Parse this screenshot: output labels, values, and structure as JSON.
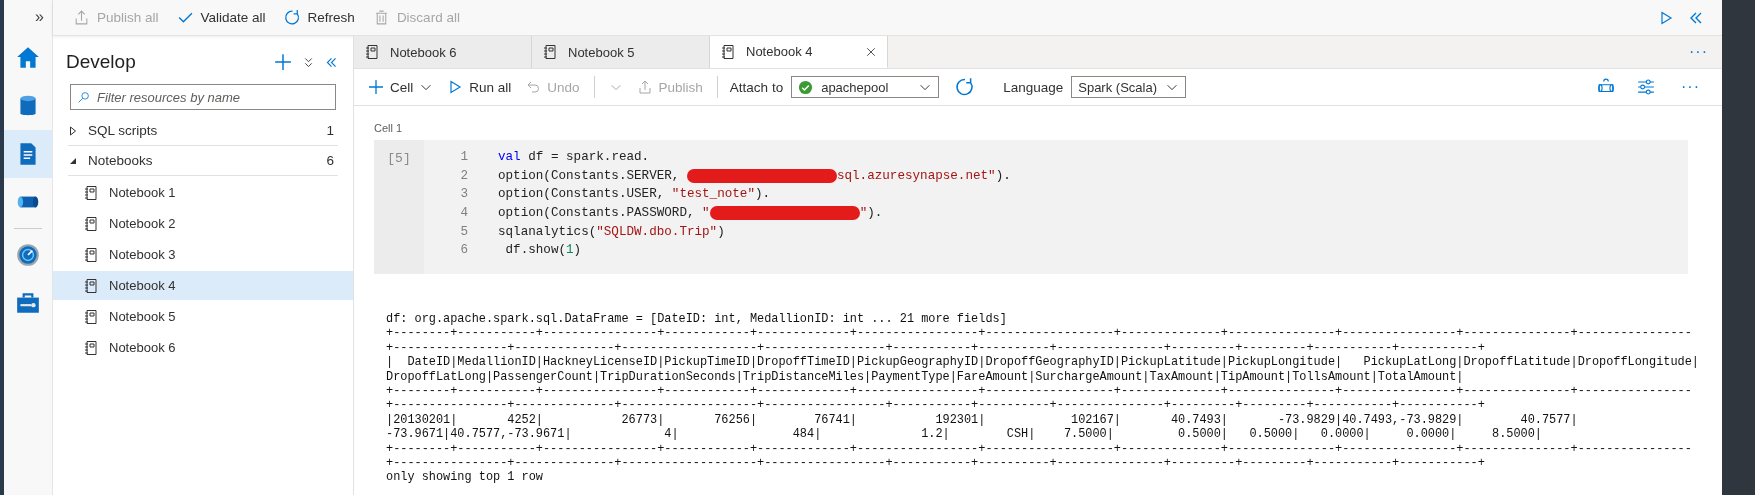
{
  "rail": {
    "expand": "»",
    "groups": [
      [
        {
          "kind": "home",
          "selected": false
        },
        {
          "kind": "data",
          "selected": false
        },
        {
          "kind": "develop",
          "selected": true
        },
        {
          "kind": "integrate",
          "selected": false
        }
      ],
      [
        {
          "kind": "monitor",
          "selected": false
        },
        {
          "kind": "manage",
          "selected": false
        }
      ]
    ]
  },
  "toolbar": {
    "actions": [
      {
        "kind": "publish",
        "label": "Publish all",
        "disabled": true
      },
      {
        "kind": "validate",
        "label": "Validate all",
        "disabled": false
      },
      {
        "kind": "refresh",
        "label": "Refresh",
        "disabled": false
      },
      {
        "kind": "discard",
        "label": "Discard all",
        "disabled": true
      }
    ],
    "end_icons": [
      {
        "kind": "run"
      },
      {
        "kind": "collapse"
      }
    ]
  },
  "sidebar": {
    "title": "Develop",
    "header_icons": [
      {
        "kind": "add"
      },
      {
        "kind": "collapse-all"
      },
      {
        "kind": "collapse"
      }
    ],
    "search": {
      "placeholder": "Filter resources by name"
    },
    "tree": [
      {
        "label": "SQL scripts",
        "count": "1",
        "expanded": false
      },
      {
        "label": "Notebooks",
        "count": "6",
        "expanded": true,
        "children": [
          {
            "label": "Notebook 1",
            "selected": false
          },
          {
            "label": "Notebook 2",
            "selected": false
          },
          {
            "label": "Notebook 3",
            "selected": false
          },
          {
            "label": "Notebook 4",
            "selected": true
          },
          {
            "label": "Notebook 5",
            "selected": false
          },
          {
            "label": "Notebook 6",
            "selected": false
          }
        ]
      }
    ]
  },
  "tabs": [
    {
      "label": "Notebook 6",
      "selected": false
    },
    {
      "label": "Notebook 5",
      "selected": false
    },
    {
      "label": "Notebook 4",
      "selected": true
    }
  ],
  "tabs_more": "···",
  "cell_toolbar": {
    "items": [
      {
        "kind": "add",
        "label": "Cell",
        "disabled": false,
        "caret": true
      },
      {
        "kind": "run",
        "label": "Run all",
        "disabled": false,
        "caret": false
      },
      {
        "kind": "undo",
        "label": "Undo",
        "disabled": true,
        "caret": false
      },
      {
        "kind": "split",
        "disabled": true,
        "caret": true
      },
      {
        "kind": "publish",
        "label": "Publish",
        "disabled": true,
        "caret": false
      }
    ],
    "attach": {
      "label": "Attach to",
      "value": "apachepool",
      "connected": true
    },
    "language": {
      "label": "Language",
      "value": "Spark (Scala)"
    },
    "end_icons": [
      {
        "kind": "spool"
      },
      {
        "kind": "sliders"
      }
    ],
    "more": "···"
  },
  "cell": {
    "label": "Cell 1",
    "execution_count": "[5]",
    "lines": [
      {
        "number": "1",
        "tokens": [
          {
            "kind": "keyword",
            "text": "val"
          },
          {
            "kind": "plain",
            "text": " df = spark.read."
          }
        ]
      },
      {
        "number": "2",
        "tokens": [
          {
            "kind": "plain",
            "text": "option(Constants.SERVER, "
          },
          {
            "kind": "redacted"
          },
          {
            "kind": "string",
            "text": "sql.azuresynapse.net\""
          },
          {
            "kind": "plain",
            "text": ")."
          }
        ]
      },
      {
        "number": "3",
        "tokens": [
          {
            "kind": "plain",
            "text": "option(Constants.USER, "
          },
          {
            "kind": "string",
            "text": "\"test_note\""
          },
          {
            "kind": "plain",
            "text": ")."
          }
        ]
      },
      {
        "number": "4",
        "tokens": [
          {
            "kind": "plain",
            "text": "option(Constants.PASSWORD, "
          },
          {
            "kind": "string",
            "text": "\""
          },
          {
            "kind": "redacted"
          },
          {
            "kind": "string",
            "text": "\""
          },
          {
            "kind": "plain",
            "text": ")."
          }
        ]
      },
      {
        "number": "5",
        "tokens": [
          {
            "kind": "plain",
            "text": "sqlanalytics("
          },
          {
            "kind": "string",
            "text": "\"SQLDW.dbo.Trip\""
          },
          {
            "kind": "plain",
            "text": ")"
          }
        ]
      },
      {
        "number": "6",
        "tokens": [
          {
            "kind": "plain",
            "text": " df.show("
          },
          {
            "kind": "number",
            "text": "1"
          },
          {
            "kind": "plain",
            "text": ")"
          }
        ]
      }
    ],
    "output": [
      "df: org.apache.spark.sql.DataFrame = [DateID: int, MedallionID: int ... 21 more fields]",
      "+--------+-----------+----------------+------------+-------------+-----------------+------------------+--------------+---------------+----------------+---------------+----------------",
      "+----------------+--------------+-------------------+-----------------+-----------+----------+---------------+---------+---------+-----------+-----------+",
      "|  DateID|MedallionID|HackneyLicenseID|PickupTimeID|DropoffTimeID|PickupGeographyID|DropoffGeographyID|PickupLatitude|PickupLongitude|   PickupLatLong|DropoffLatitude|DropoffLongitude|",
      "DropoffLatLong|PassengerCount|TripDurationSeconds|TripDistanceMiles|PaymentType|FareAmount|SurchargeAmount|TaxAmount|TipAmount|TollsAmount|TotalAmount|",
      "+--------+-----------+----------------+------------+-------------+-----------------+------------------+--------------+---------------+----------------+---------------+----------------",
      "+----------------+--------------+-------------------+-----------------+-----------+----------+---------------+---------+---------+-----------+-----------+",
      "|20130201|       4252|           26773|       76256|        76741|           192301|            102167|       40.7493|       -73.9829|40.7493,-73.9829|        40.7577|",
      "-73.9671|40.7577,-73.9671|             4|                484|              1.2|        CSH|    7.5000|         0.5000|   0.5000|   0.0000|     0.0000|     8.5000|",
      "+--------+-----------+----------------+------------+-------------+-----------------+------------------+--------------+---------------+----------------+---------------+----------------",
      "+----------------+--------------+-------------------+-----------------+-----------+----------+---------------+---------+---------+-----------+-----------+",
      "only showing top 1 row"
    ]
  }
}
